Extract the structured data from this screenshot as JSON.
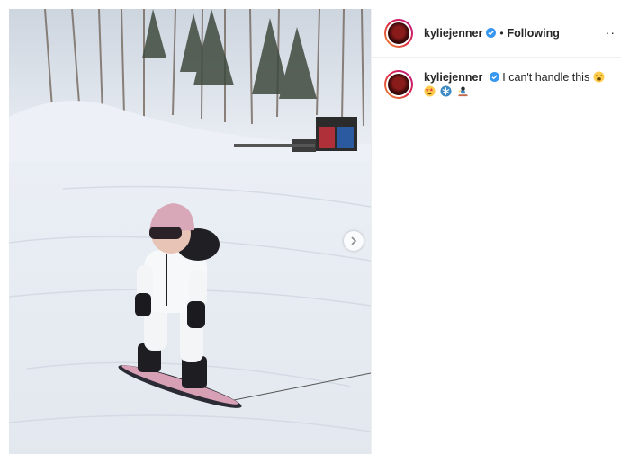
{
  "header": {
    "username": "kyliejenner",
    "follow_separator": "•",
    "follow_state": "Following",
    "more_label": "··"
  },
  "caption": {
    "username": "kyliejenner",
    "text": "I can't handle this",
    "emojis": [
      "tired-face-emoji",
      "star-struck-emoji",
      "snowflake-emoji",
      "snowboarder-emoji"
    ]
  },
  "media": {
    "description_icon": "snowboarding-child-photo",
    "carousel_next_icon": "chevron-right-icon"
  },
  "colors": {
    "verified_blue": "#3897f0",
    "divider": "#efefef",
    "text": "#262626"
  }
}
